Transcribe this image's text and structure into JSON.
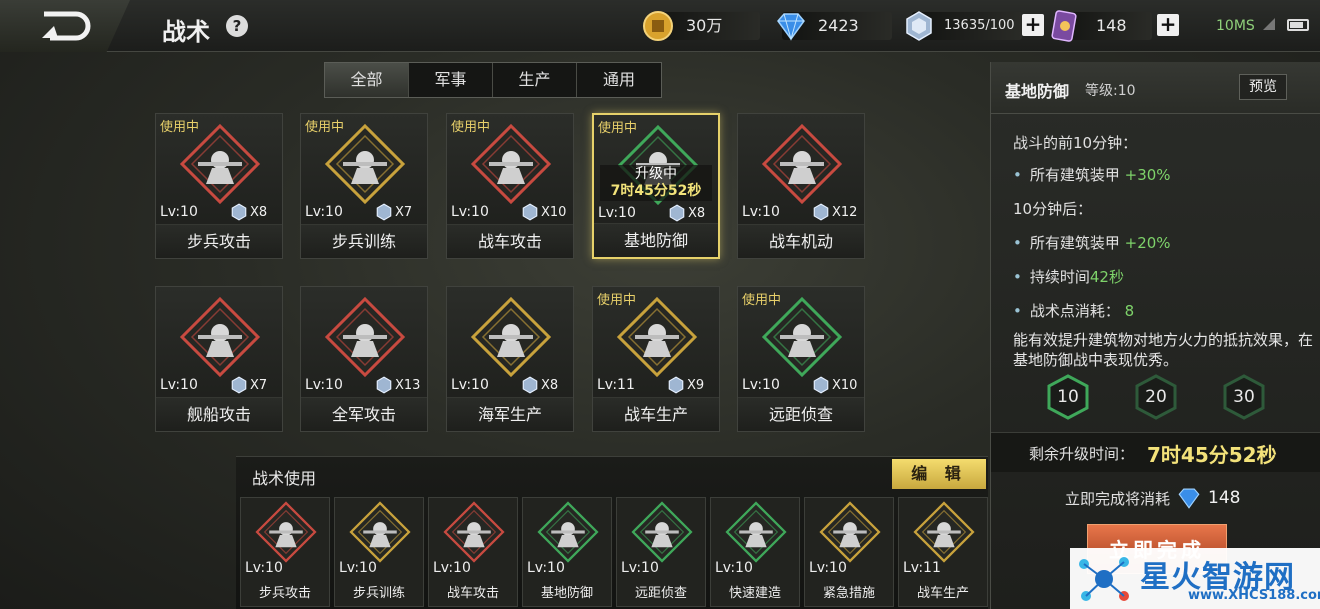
{
  "header": {
    "title": "战术",
    "help": "?",
    "resources": [
      {
        "name": "gold-coin",
        "value": "30万"
      },
      {
        "name": "diamond",
        "value": "2423"
      },
      {
        "name": "crystal",
        "value": "13635/100"
      },
      {
        "name": "card",
        "value": "148"
      }
    ],
    "ping": "10MS"
  },
  "tabs": [
    "全部",
    "军事",
    "生产",
    "通用"
  ],
  "in_use_label": "使用中",
  "tactics": [
    {
      "name": "步兵攻击",
      "level": "Lv:10",
      "cost": "X8",
      "in_use": true,
      "color": "#c84a40"
    },
    {
      "name": "步兵训练",
      "level": "Lv:10",
      "cost": "X7",
      "in_use": true,
      "color": "#c8a23c"
    },
    {
      "name": "战车攻击",
      "level": "Lv:10",
      "cost": "X10",
      "in_use": true,
      "color": "#c84a40"
    },
    {
      "name": "基地防御",
      "level": "Lv:10",
      "cost": "X8",
      "in_use": true,
      "color": "#3fa85a",
      "upgrading": true
    },
    {
      "name": "战车机动",
      "level": "Lv:10",
      "cost": "X12",
      "in_use": false,
      "color": "#c84a40"
    },
    {
      "name": "舰船攻击",
      "level": "Lv:10",
      "cost": "X7",
      "in_use": false,
      "color": "#c84a40"
    },
    {
      "name": "全军攻击",
      "level": "Lv:10",
      "cost": "X13",
      "in_use": false,
      "color": "#c84a40"
    },
    {
      "name": "海军生产",
      "level": "Lv:10",
      "cost": "X8",
      "in_use": false,
      "color": "#c8a23c"
    },
    {
      "name": "战车生产",
      "level": "Lv:11",
      "cost": "X9",
      "in_use": true,
      "color": "#c8a23c"
    },
    {
      "name": "远距侦查",
      "level": "Lv:10",
      "cost": "X10",
      "in_use": true,
      "color": "#3fa85a"
    }
  ],
  "upgrade": {
    "label": "升级中",
    "time": "7时45分52秒"
  },
  "bottom": {
    "title": "战术使用",
    "edit": "编 辑",
    "slots": [
      {
        "name": "步兵攻击",
        "level": "Lv:10",
        "color": "#c84a40"
      },
      {
        "name": "步兵训练",
        "level": "Lv:10",
        "color": "#c8a23c"
      },
      {
        "name": "战车攻击",
        "level": "Lv:10",
        "color": "#c84a40"
      },
      {
        "name": "基地防御",
        "level": "Lv:10",
        "color": "#3fa85a"
      },
      {
        "name": "远距侦查",
        "level": "Lv:10",
        "color": "#3fa85a"
      },
      {
        "name": "快速建造",
        "level": "Lv:10",
        "color": "#3fa85a"
      },
      {
        "name": "紧急措施",
        "level": "Lv:10",
        "color": "#c8a23c"
      },
      {
        "name": "战车生产",
        "level": "Lv:11",
        "color": "#c8a23c"
      }
    ]
  },
  "detail": {
    "name": "基地防御",
    "level": "等级:10",
    "preview": "预览",
    "line1": "战斗的前10分钟：",
    "b1_label": "所有建筑装甲",
    "b1_value": "+30%",
    "line2": "10分钟后：",
    "b2_label": "所有建筑装甲",
    "b2_value": "+20%",
    "b3_label": "持续时间",
    "b3_value": "42秒",
    "b4_label": "战术点消耗：",
    "b4_value": "8",
    "description": "能有效提升建筑物对地方火力的抵抗效果，在基地防御战中表现优秀。",
    "levels": [
      "10",
      "20",
      "30"
    ],
    "remaining_label": "剩余升级时间：",
    "remaining_value": "7时45分52秒",
    "finish_cost_label": "立即完成将消耗",
    "finish_cost_value": "148",
    "finish_button": "立即完成"
  },
  "watermark": {
    "name": "星火智游网",
    "url": "www.XHCS188.com"
  }
}
